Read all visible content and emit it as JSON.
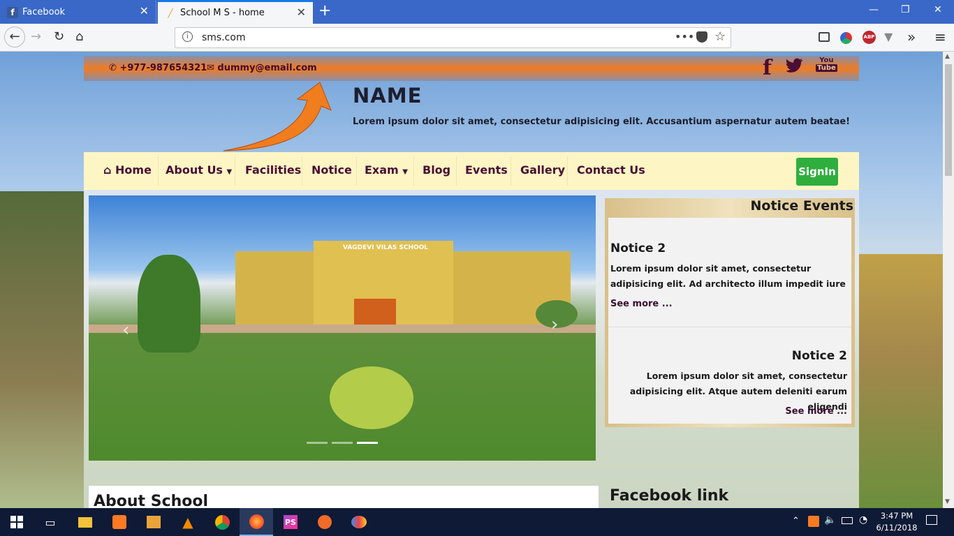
{
  "browser": {
    "tabs": [
      {
        "title": "Facebook",
        "favicon": "facebook-icon"
      },
      {
        "title": "School M S - home",
        "favicon": "brush-icon"
      }
    ],
    "url": "sms.com",
    "extensions": [
      "reader-icon",
      "colors-icon",
      "adblock-icon",
      "v-icon"
    ],
    "extension_badges": {
      "adblock": "ABP"
    }
  },
  "site": {
    "phone": "+977-987654321",
    "email": "dummy@email.com",
    "social": {
      "facebook": "f",
      "youtube_top": "You",
      "youtube_bottom": "Tube"
    },
    "name": "NAME",
    "tagline": "Lorem ipsum dolor sit amet, consectetur adipisicing elit. Accusantium aspernatur autem beatae!",
    "menu": {
      "home": "Home",
      "about": "About Us",
      "facilities": "Facilities",
      "notice": "Notice",
      "exam": "Exam",
      "blog": "Blog",
      "events": "Events",
      "gallery": "Gallery",
      "contact": "Contact Us",
      "signin": "SignIn"
    },
    "slider": {
      "school_sign": "VAGDEVI VILAS SCHOOL",
      "active_slide": 3,
      "slide_count": 3
    },
    "notice_panel": {
      "title": "Notice Events",
      "items": [
        {
          "title": "Notice 2",
          "body": "Lorem ipsum dolor sit amet, consectetur adipisicing elit. Ad architecto illum impedit iure",
          "more": "See more ..."
        },
        {
          "title": "Notice 2",
          "body": "Lorem ipsum dolor sit amet, consectetur adipisicing elit. Atque autem deleniti earum eligendi",
          "more": "See more ..."
        }
      ]
    },
    "about_title": "About School",
    "facebook_link_title": "Facebook link"
  },
  "taskbar": {
    "time": "3:47 PM",
    "date": "6/11/2018"
  },
  "colors": {
    "accent_maroon": "#4a0d34",
    "signin_green": "#2fae3e",
    "menu_bg": "#fdf6c4",
    "tab_blue": "#3a68c8"
  }
}
